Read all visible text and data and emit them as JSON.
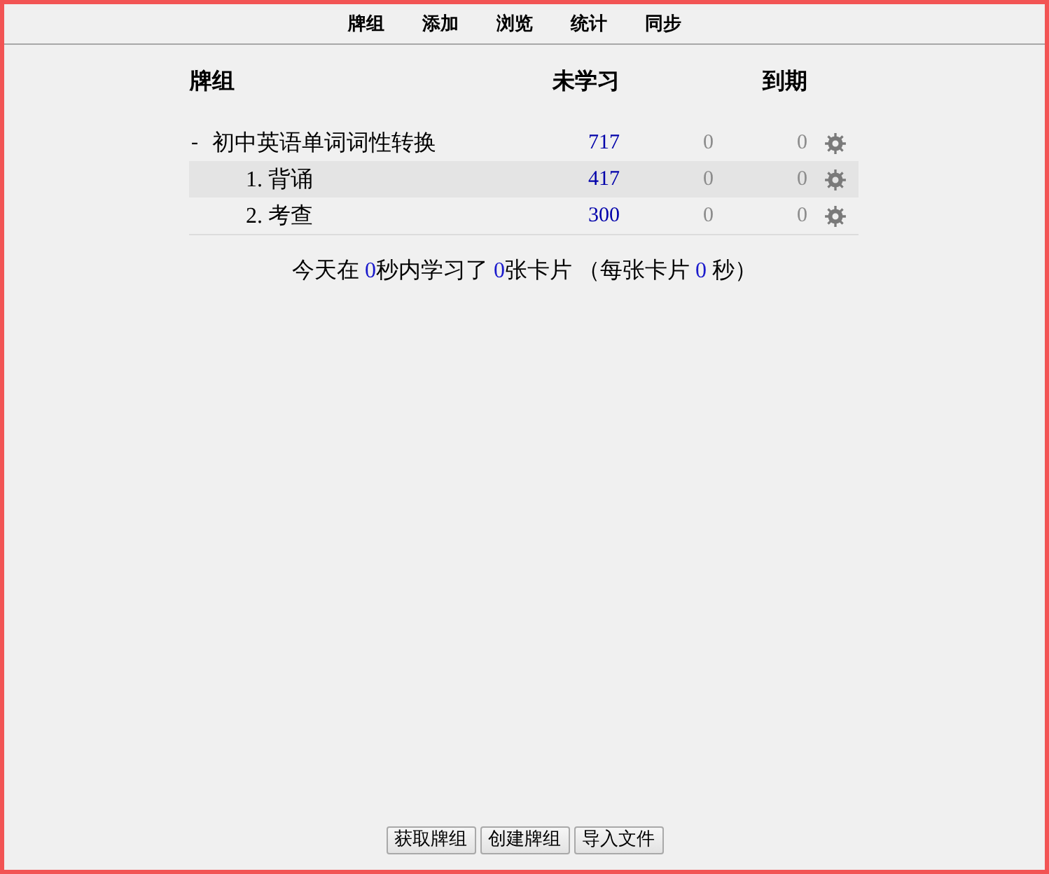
{
  "nav": [
    {
      "label": "牌组"
    },
    {
      "label": "添加"
    },
    {
      "label": "浏览"
    },
    {
      "label": "统计"
    },
    {
      "label": "同步"
    }
  ],
  "columns": [
    {
      "label": "牌组"
    },
    {
      "label": "未学习"
    },
    {
      "label": "到期"
    }
  ],
  "decks": [
    {
      "toggle": "-",
      "name": "初中英语单词词性转换",
      "selected": false,
      "counts": [
        {
          "text": "717",
          "color": "#0000aa"
        },
        {
          "text": "0",
          "color": "#8c8c8c"
        },
        {
          "text": "0",
          "color": "#8c8c8c"
        }
      ],
      "children": [
        {
          "name": "1. 背诵",
          "selected": true,
          "counts": [
            {
              "text": "417",
              "color": "#0000aa"
            },
            {
              "text": "0",
              "color": "#8c8c8c"
            },
            {
              "text": "0",
              "color": "#8c8c8c"
            }
          ]
        },
        {
          "name": "2. 考查",
          "selected": false,
          "counts": [
            {
              "text": "300",
              "color": "#0000aa"
            },
            {
              "text": "0",
              "color": "#8c8c8c"
            },
            {
              "text": "0",
              "color": "#8c8c8c"
            }
          ]
        }
      ]
    }
  ],
  "summary": [
    {
      "text": "今天在 ",
      "highlight": false
    },
    {
      "text": "0",
      "highlight": true
    },
    {
      "text": "秒内学习了 ",
      "highlight": false
    },
    {
      "text": "0",
      "highlight": true
    },
    {
      "text": "张卡片 （每张卡片 ",
      "highlight": false
    },
    {
      "text": "0",
      "highlight": true
    },
    {
      "text": " 秒）",
      "highlight": false
    }
  ],
  "buttons": [
    {
      "label": "获取牌组"
    },
    {
      "label": "创建牌组"
    },
    {
      "label": "导入文件"
    }
  ]
}
